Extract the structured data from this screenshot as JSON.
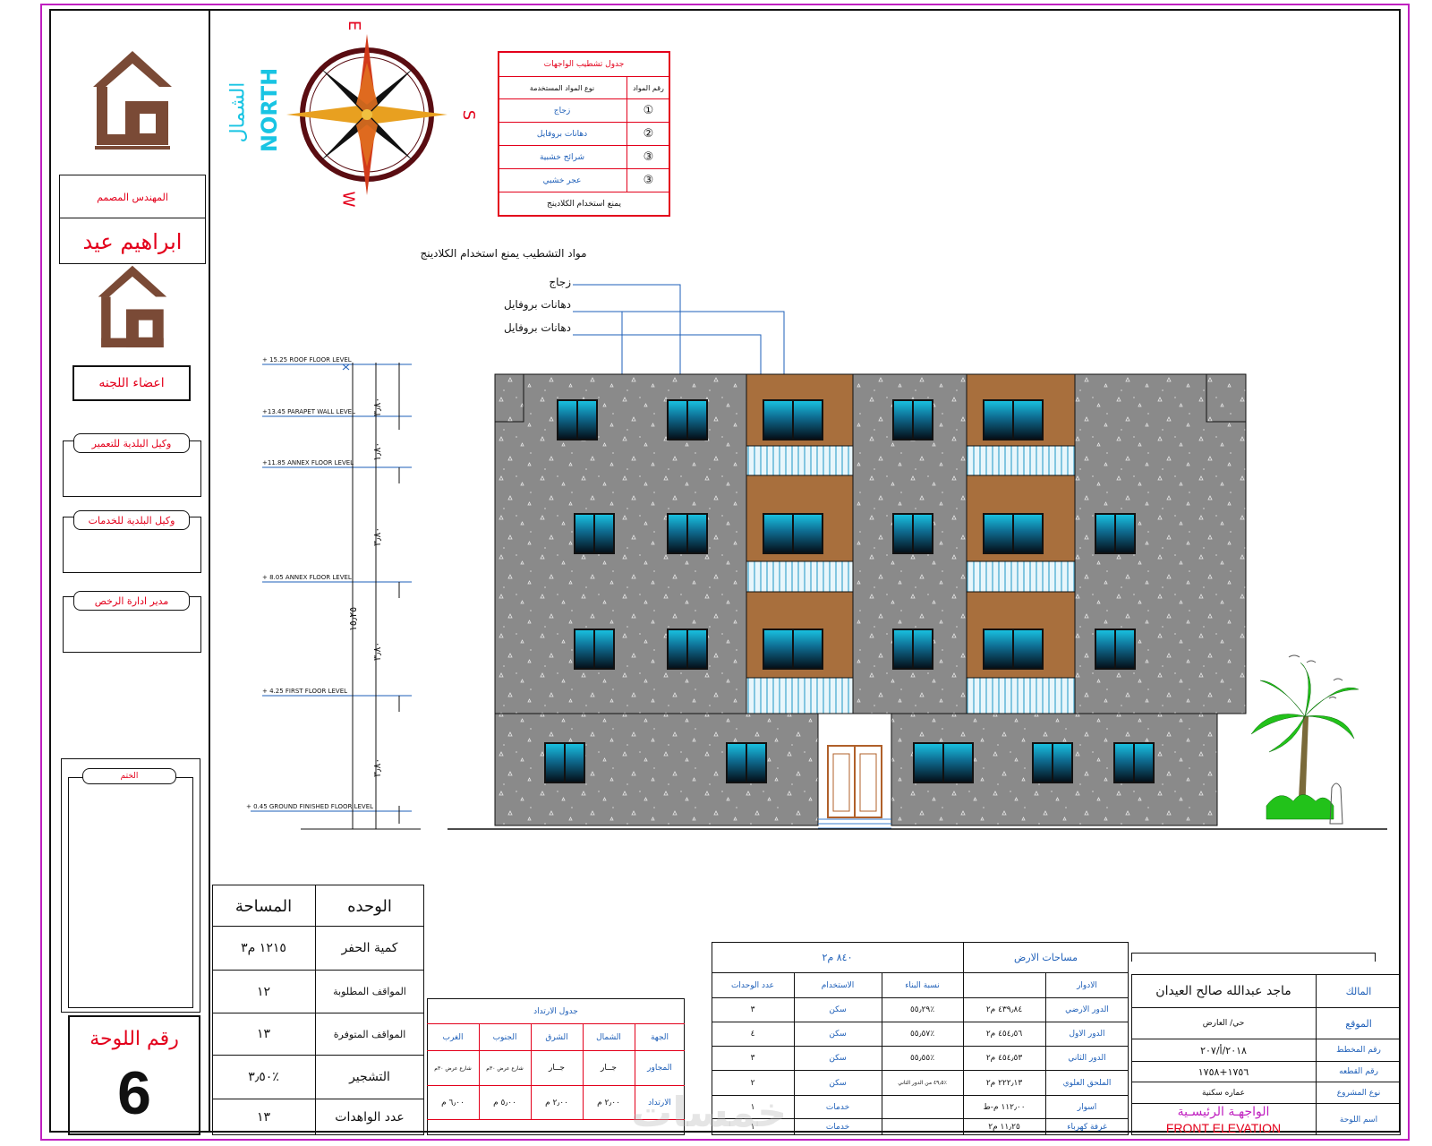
{
  "left_panel": {
    "designer_label": "المهندس المصمم",
    "designer_name": "ابراهيم عيد",
    "committee_label": "اعضاء اللجنه",
    "approvals": [
      "وكيل البلدية للتعمير",
      "وكيل البلدية للخدمات",
      "مدير ادارة الرخص"
    ],
    "stamp_label": "الختم",
    "sheet_label": "رقم اللوحة",
    "sheet_number": "6"
  },
  "compass": {
    "north_ar": "الشمال",
    "north_en": "NORTH",
    "e": "E",
    "s": "S",
    "w": "W"
  },
  "finishes_table": {
    "title": "جدول تشطيب الواجهات",
    "col_material": "نوع المواد المستخدمة",
    "col_number": "رقم المواد",
    "rows": [
      {
        "no": "①",
        "name": "زجاج"
      },
      {
        "no": "②",
        "name": "دهانات بروفايل"
      },
      {
        "no": "③",
        "name": "شرائح خشبية"
      },
      {
        "no": "③",
        "name": "عجر خشبي"
      }
    ],
    "footer": "يمنع استخدام الكلادينج"
  },
  "callouts": {
    "title": "مواد التشطيب يمنع استخدام الكلادينج",
    "items": [
      "زجاج",
      "دهانات بروفايل",
      "دهانات بروفايل"
    ]
  },
  "levels": [
    {
      "label": "+ 15.25  ROOF FLOOR LEVEL"
    },
    {
      "label": "+13.45  PARAPET WALL LEVEL"
    },
    {
      "label": "+11.85  ANNEX FLOOR LEVEL"
    },
    {
      "label": "+ 8.05  ANNEX FLOOR LEVEL"
    },
    {
      "label": "+ 4.25  FIRST FLOOR LEVEL"
    },
    {
      "label": "+ 0.45  GROUND FINISHED FLOOR LEVEL"
    }
  ],
  "dims": [
    "٣٫٨٠",
    "١٥٫٢٥",
    "٣٫٨٠",
    "٣٫٨٠",
    "١٫٨٠",
    "٣٫٨٠"
  ],
  "units_table": {
    "col_unit": "الوحده",
    "col_area": "المساحة",
    "rows": [
      {
        "label": "كمية الحفر",
        "value": "١٢١٥ م٣"
      },
      {
        "label": "المواقف المطلوبة",
        "value": "١٢"
      },
      {
        "label": "المواقف المتوفرة",
        "value": "١٣"
      },
      {
        "label": "التشجير",
        "value": "٪٣٫٥٠"
      },
      {
        "label": "عدد الواهدات",
        "value": "١٣"
      }
    ]
  },
  "setback_table": {
    "title": "جدول الارتداد",
    "headers": [
      "الجهة",
      "الشمال",
      "الشرق",
      "الجنوب",
      "الغرب"
    ],
    "neighbors_label": "المجاور",
    "neighbors": [
      "جــار",
      "جــار",
      "شارع عرض ٣٠م",
      "شارع عرض ٣٠م"
    ],
    "setback_label": "الارتداد",
    "setbacks": [
      "٢٫٠٠ م",
      "٢٫٠٠ م",
      "٥٫٠٠ م",
      "٦٫٠٠ م"
    ]
  },
  "areas_table": {
    "land_area_label": "مساحات الارض",
    "land_area_value": "٨٤٠ م٢",
    "headers": [
      "الادوار",
      "",
      "نسبة البناء",
      "الاستخدام",
      "عدد الوحدات"
    ],
    "rows": [
      {
        "floor": "الدور الارضي",
        "area": "٤٣٩٫٨٤ م٢",
        "ratio": "٪٥٥٫٢٩",
        "use": "سكن",
        "units": "٣"
      },
      {
        "floor": "الدور الاول",
        "area": "٤٥٤٫٥٦ م٢",
        "ratio": "٪٥٥٫٥٧",
        "use": "سكن",
        "units": "٤"
      },
      {
        "floor": "الدور الثاني",
        "area": "٤٥٤٫٥٣ م٢",
        "ratio": "٪٥٥٫٥٥",
        "use": "سكن",
        "units": "٣"
      },
      {
        "floor": "الملحق العلوي",
        "area": "٢٢٢٫١٣ م٢",
        "ratio": "٪٤٩٫٥ من الدور الثاني",
        "use": "سكن",
        "units": "٢"
      },
      {
        "floor": "اسوار",
        "area": "١١٢٫٠٠ م-ط",
        "ratio": "",
        "use": "خدمات",
        "units": "١"
      },
      {
        "floor": "غرفة كهرباء",
        "area": "١١٫٢٥ م٢",
        "ratio": "",
        "use": "خدمات",
        "units": "١"
      }
    ]
  },
  "title_block": {
    "owner_label": "المالك",
    "owner": "ماجد عبدالله صالح العيدان",
    "location_label": "الموقع",
    "location": "حي/ العارض",
    "plan_label": "رقم المخطط",
    "plan": "٢٠١٨/أ/٢٠٧",
    "plot_label": "رقم القطعه",
    "plot": "١٧٥٦+١٧٥٨",
    "project_label": "نوع المشروع",
    "project": "عماره سكنية",
    "sheet_name_label": "اسم اللوحة",
    "sheet_name_ar": "الواجهـة الرئيسـية",
    "sheet_name_en": "FRONT ELEVATION"
  },
  "watermark": "خمسات",
  "colors": {
    "frame": "#c020c0",
    "red": "#e3001b",
    "wall": "#8a8a8a",
    "wood": "#a86f3d",
    "glass": "#0e6a8f",
    "cyan": "#19c4e3",
    "logo": "#7a4a36"
  }
}
